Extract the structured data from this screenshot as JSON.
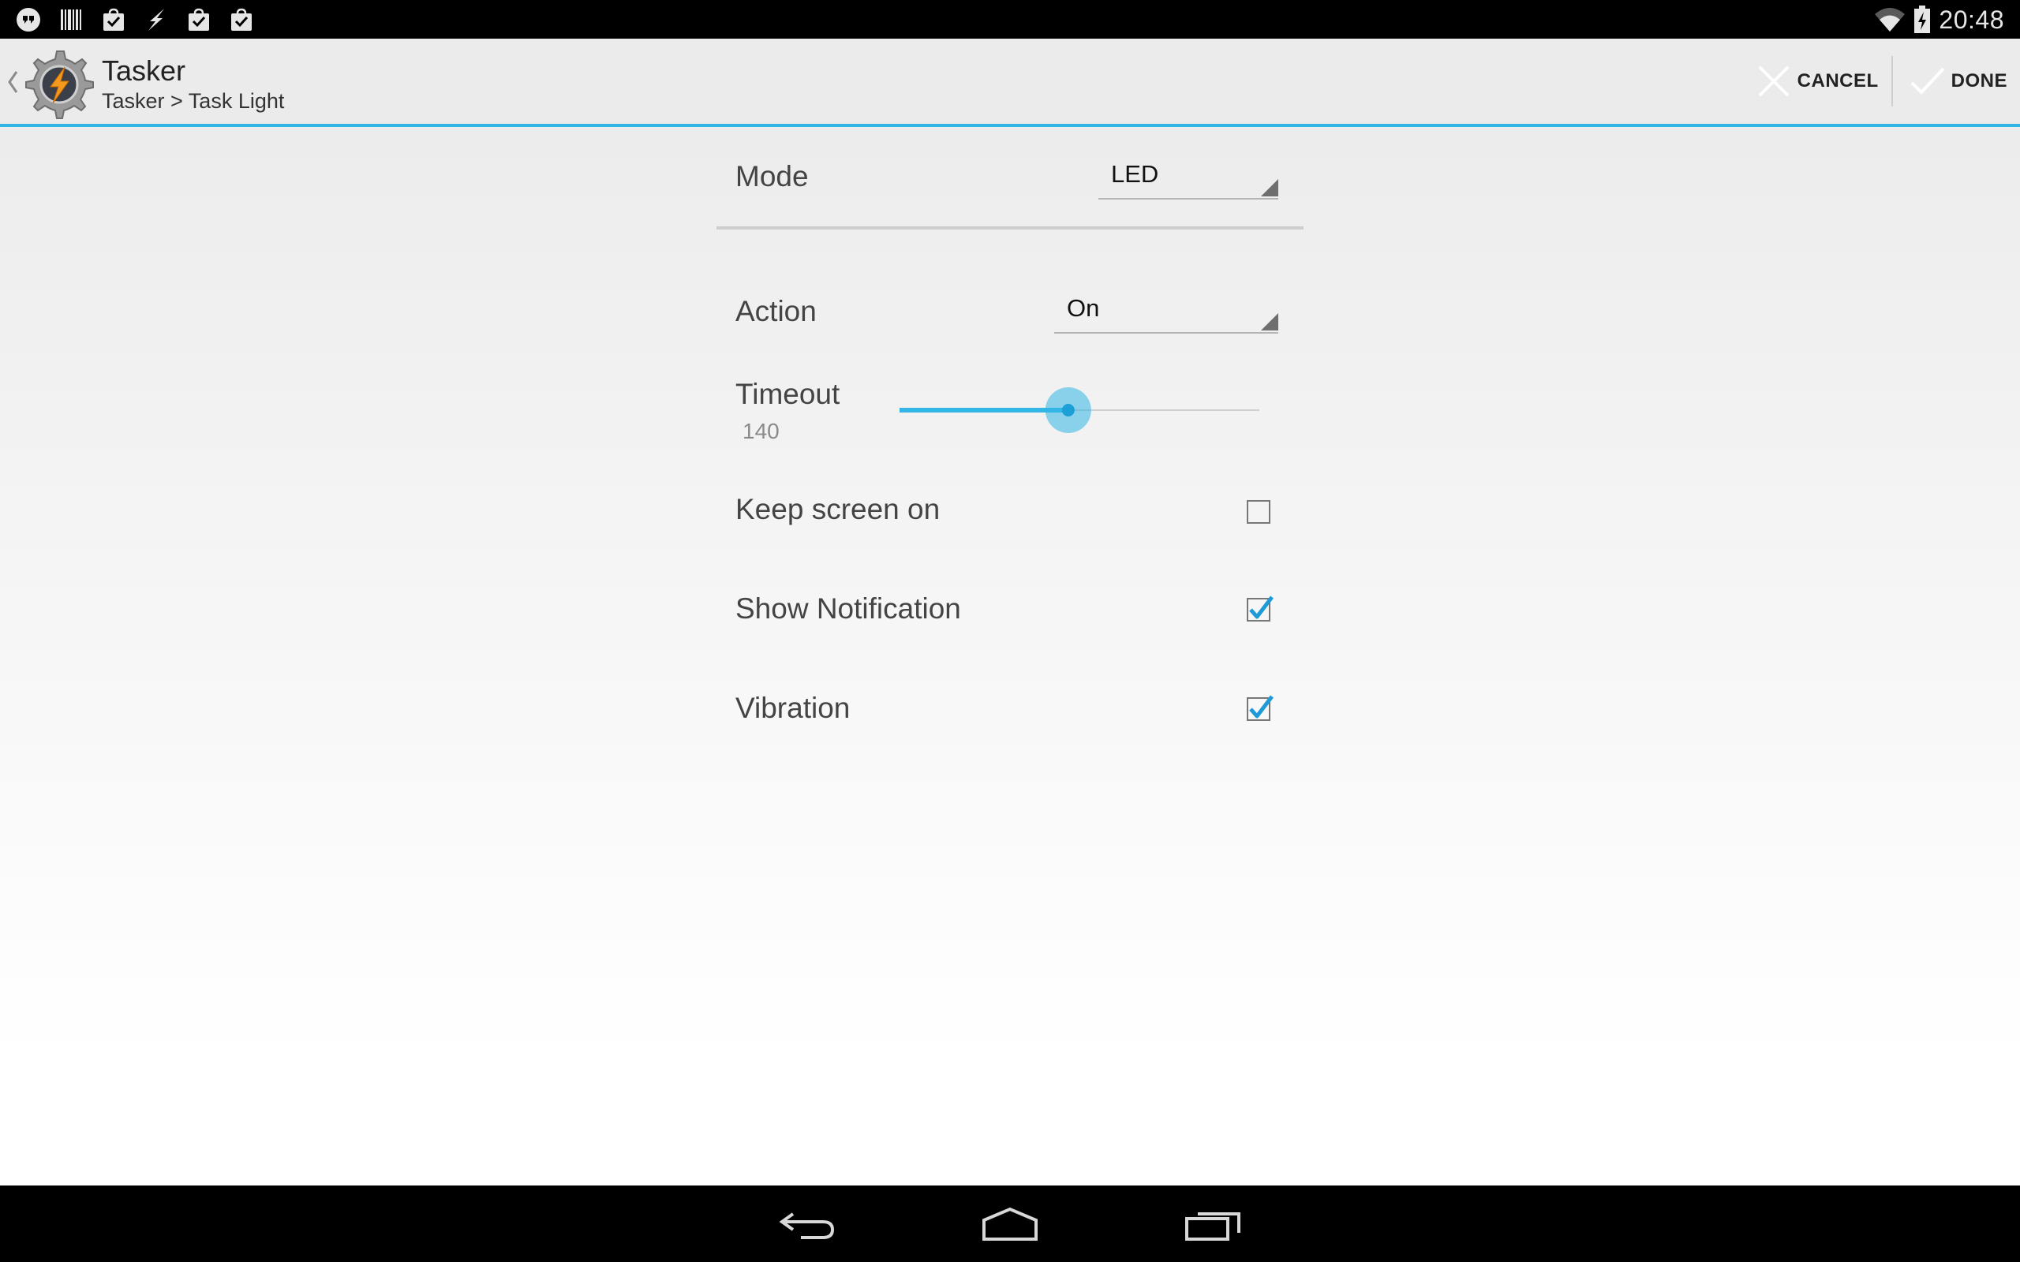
{
  "status_bar": {
    "time": "20:48",
    "icons": [
      "hangouts-icon",
      "barcode-icon",
      "shopping-bag-check-icon",
      "flash-icon",
      "shopping-bag-check-icon",
      "shopping-bag-check-icon",
      "wifi-icon",
      "battery-charging-icon"
    ]
  },
  "action_bar": {
    "title": "Tasker",
    "subtitle": "Tasker > Task Light",
    "cancel_label": "CANCEL",
    "done_label": "DONE"
  },
  "form": {
    "mode": {
      "label": "Mode",
      "value": "LED"
    },
    "action": {
      "label": "Action",
      "value": "On"
    },
    "timeout": {
      "label": "Timeout",
      "value": "140",
      "slider_fraction": 0.466
    },
    "keep_screen_on": {
      "label": "Keep screen on",
      "checked": false
    },
    "show_notification": {
      "label": "Show Notification",
      "checked": true
    },
    "vibration": {
      "label": "Vibration",
      "checked": true
    }
  },
  "colors": {
    "accent": "#33b5e5",
    "checkbox_blue": "#1e9bd7"
  }
}
